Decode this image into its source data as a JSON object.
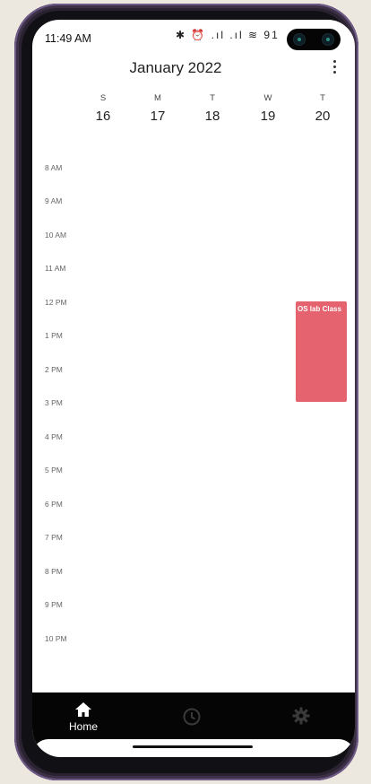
{
  "status_bar": {
    "time": "11:49 AM",
    "icons": "✱ ⏰ .ıl .ıl ≋ 91",
    "battery": "91"
  },
  "calendar": {
    "title": "January 2022",
    "days": [
      {
        "letter": "S",
        "number": "16"
      },
      {
        "letter": "M",
        "number": "17"
      },
      {
        "letter": "T",
        "number": "18"
      },
      {
        "letter": "W",
        "number": "19"
      },
      {
        "letter": "T",
        "number": "20"
      }
    ],
    "hours": [
      "8 AM",
      "9 AM",
      "10 AM",
      "11 AM",
      "12 PM",
      "1 PM",
      "2 PM",
      "3 PM",
      "4 PM",
      "5 PM",
      "6 PM",
      "7 PM",
      "8 PM",
      "9 PM",
      "10 PM"
    ],
    "events": [
      {
        "title": "OS lab Class",
        "day": "20",
        "start": "12 PM",
        "end": "3 PM",
        "color": "#e4636f"
      }
    ]
  },
  "bottom_nav": {
    "items": [
      {
        "label": "Home",
        "icon": "home-icon",
        "active": true
      },
      {
        "label": "",
        "icon": "clock-icon",
        "active": false
      },
      {
        "label": "",
        "icon": "gear-icon",
        "active": false
      }
    ]
  }
}
